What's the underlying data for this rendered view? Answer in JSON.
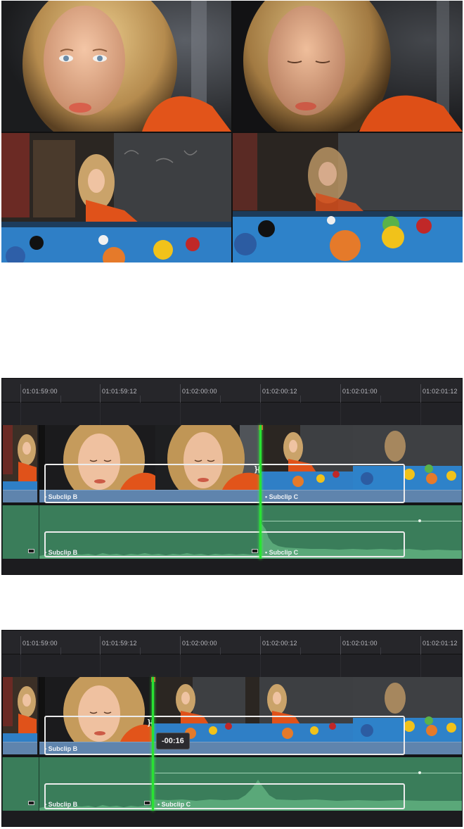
{
  "viewer": {
    "frames": [
      "closeup-face-warm",
      "closeup-face-graded",
      "wide-pool-shot",
      "wide-pool-shot-defocus"
    ]
  },
  "timeline_top": {
    "ruler": [
      "01:01:59:00",
      "01:01:59:12",
      "01:02:00:00",
      "01:02:00:12",
      "01:02:01:00",
      "01:02:01:12"
    ],
    "video_clips": [
      "Subclip B",
      "Subclip C"
    ],
    "audio_clips": [
      "Subclip B",
      "Subclip C"
    ]
  },
  "timeline_bottom": {
    "ruler": [
      "01:01:59:00",
      "01:01:59:12",
      "01:02:00:00",
      "01:02:00:12",
      "01:02:01:00",
      "01:02:01:12"
    ],
    "video_clips": [
      "Subclip B"
    ],
    "audio_clips": [
      "Subclip B",
      "Subclip C"
    ],
    "trim_offset": "-00:16"
  },
  "colors": {
    "video_clip": "#5f84ad",
    "audio_track": "#3a7d5a",
    "playhead": "#29e233",
    "selection": "#ececec"
  }
}
